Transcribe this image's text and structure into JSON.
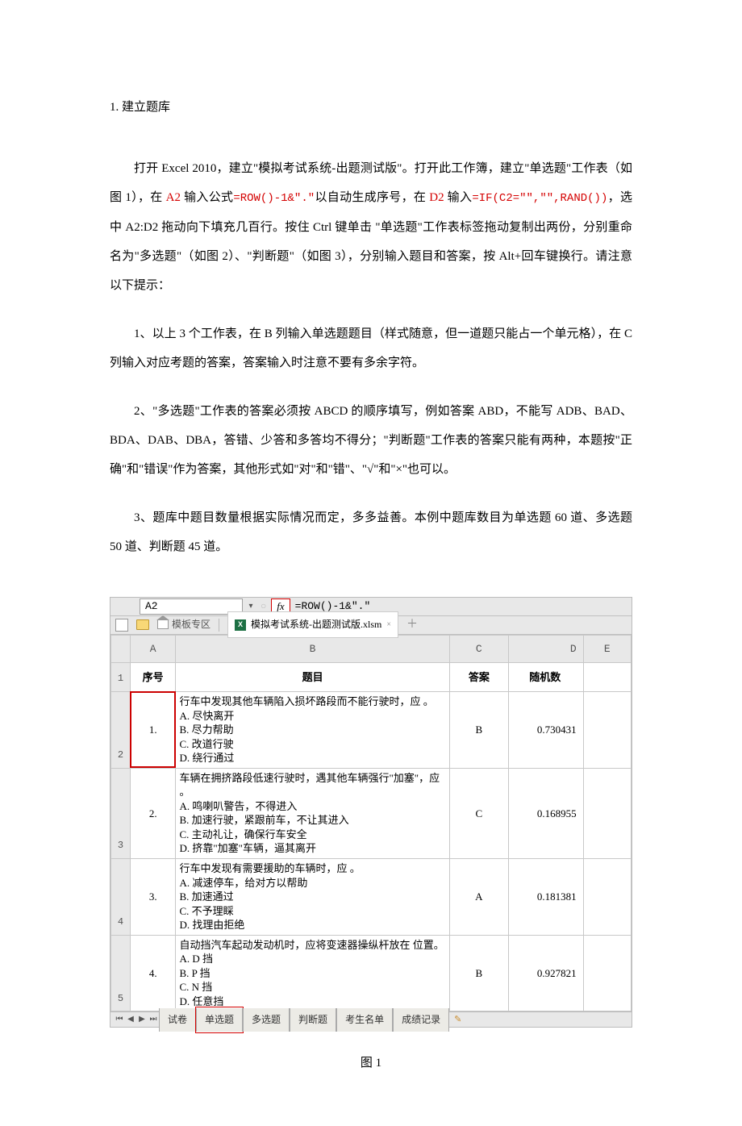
{
  "doc": {
    "section_title": "1. 建立题库",
    "p1_a": "打开 Excel 2010，建立\"模拟考试系统-出题测试版\"。打开此工作簿，建立\"单选题\"工作表（如图 1），在 ",
    "p1_a2": "A2",
    "p1_b": " 输入公式",
    "p1_formula1": "=ROW()-1&\".\"",
    "p1_c": "以自动生成序号，在 ",
    "p1_d2": "D2",
    "p1_d": " 输入",
    "p1_formula2": "=IF(C2=\"\",\"\",RAND())",
    "p1_e": "，选中 A2:D2 拖动向下填充几百行。按住 Ctrl 键单击 \"单选题\"工作表标签拖动复制出两份，分别重命名为\"多选题\"（如图 2）、\"判断题\"（如图 3），分别输入题目和答案，按 Alt+回车键换行。请注意以下提示：",
    "p2": "1、以上 3 个工作表，在 B 列输入单选题题目（样式随意，但一道题只能占一个单元格），在 C 列输入对应考题的答案，答案输入时注意不要有多余字符。",
    "p3": "2、\"多选题\"工作表的答案必须按 ABCD 的顺序填写，例如答案 ABD，不能写 ADB、BAD、BDA、DAB、DBA，答错、少答和多答均不得分；\"判断题\"工作表的答案只能有两种，本题按\"正确\"和\"错误\"作为答案，其他形式如\"对\"和\"错\"、\"√\"和\"×\"也可以。",
    "p4": "3、题库中题目数量根据实际情况而定，多多益善。本例中题库数目为单选题 60 道、多选题 50 道、判断题 45 道。"
  },
  "shot": {
    "namebox": "A2",
    "fx_label": "fx",
    "formula": "=ROW()-1&\".\"",
    "home_tab": "模板专区",
    "excel_icon_label": "X",
    "filename": "模拟考试系统-出题测试版.xlsm",
    "close_glyph": "×",
    "plus_glyph": "＋",
    "col_labels": [
      "A",
      "B",
      "C",
      "D",
      "E"
    ],
    "row_labels": [
      "1",
      "2",
      "3",
      "4",
      "5"
    ],
    "headers": {
      "A": "序号",
      "B": "题目",
      "C": "答案",
      "D": "随机数",
      "E": ""
    },
    "rows": [
      {
        "A": "1.",
        "B": "行车中发现其他车辆陷入损坏路段而不能行驶时，应    。\nA. 尽快离开\nB. 尽力帮助\nC. 改道行驶\nD. 绕行通过",
        "C": "B",
        "D": "0.730431"
      },
      {
        "A": "2.",
        "B": "车辆在拥挤路段低速行驶时，遇其他车辆强行\"加塞\"，应    。\nA. 鸣喇叭警告，不得进入\nB. 加速行驶，紧跟前车，不让其进入\nC. 主动礼让，确保行车安全\nD. 挤靠\"加塞\"车辆，逼其离开",
        "C": "C",
        "D": "0.168955"
      },
      {
        "A": "3.",
        "B": "行车中发现有需要援助的车辆时，应    。\nA. 减速停车，给对方以帮助\nB. 加速通过\nC. 不予理睬\nD. 找理由拒绝",
        "C": "A",
        "D": "0.181381"
      },
      {
        "A": "4.",
        "B": "自动挡汽车起动发动机时，应将变速器操纵杆放在    位置。\nA. D 挡\nB. P 挡\nC. N 挡\nD. 任意挡",
        "C": "B",
        "D": "0.927821"
      }
    ],
    "sheet_tabs": [
      "试卷",
      "单选题",
      "多选题",
      "判断题",
      "考生名单",
      "成绩记录"
    ],
    "active_sheet_idx": 1,
    "caption": "图 1"
  }
}
